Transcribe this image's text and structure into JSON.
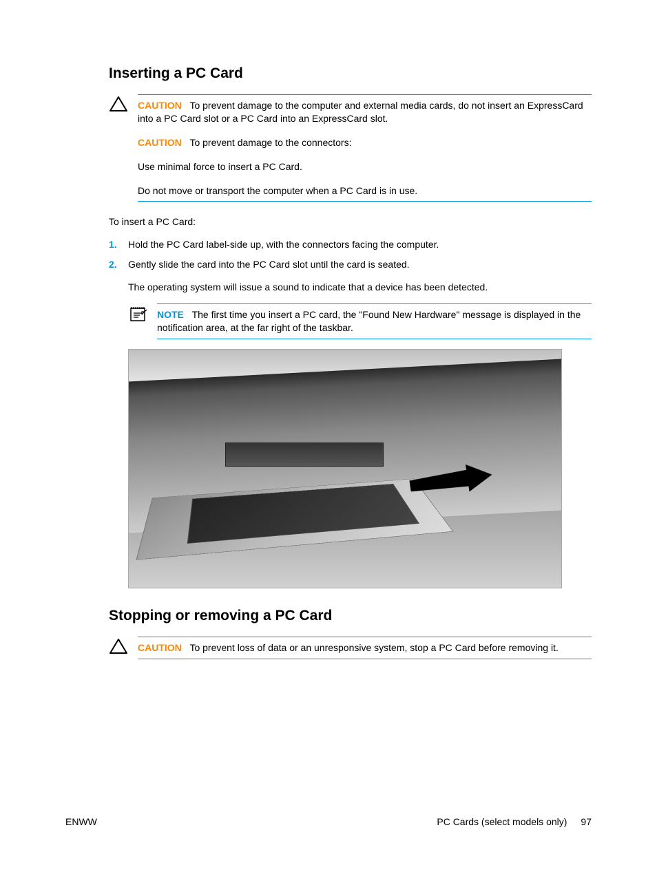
{
  "heading1": "Inserting a PC Card",
  "caution1": {
    "label": "CAUTION",
    "p1": "To prevent damage to the computer and external media cards, do not insert an ExpressCard into a PC Card slot or a PC Card into an ExpressCard slot.",
    "p2_label": "CAUTION",
    "p2": "To prevent damage to the connectors:",
    "p3": "Use minimal force to insert a PC Card.",
    "p4": "Do not move or transport the computer when a PC Card is in use."
  },
  "intro": "To insert a PC Card:",
  "steps": [
    {
      "num": "1.",
      "text": "Hold the PC Card label-side up, with the connectors facing the computer."
    },
    {
      "num": "2.",
      "text": "Gently slide the card into the PC Card slot until the card is seated."
    }
  ],
  "sub_body": "The operating system will issue a sound to indicate that a device has been detected.",
  "note1": {
    "label": "NOTE",
    "text": "The first time you insert a PC card, the \"Found New Hardware\" message is displayed in the notification area, at the far right of the taskbar."
  },
  "heading2": "Stopping or removing a PC Card",
  "caution2": {
    "label": "CAUTION",
    "text": "To prevent loss of data or an unresponsive system, stop a PC Card before removing it."
  },
  "footer": {
    "left": "ENWW",
    "section": "PC Cards (select models only)",
    "page": "97"
  }
}
